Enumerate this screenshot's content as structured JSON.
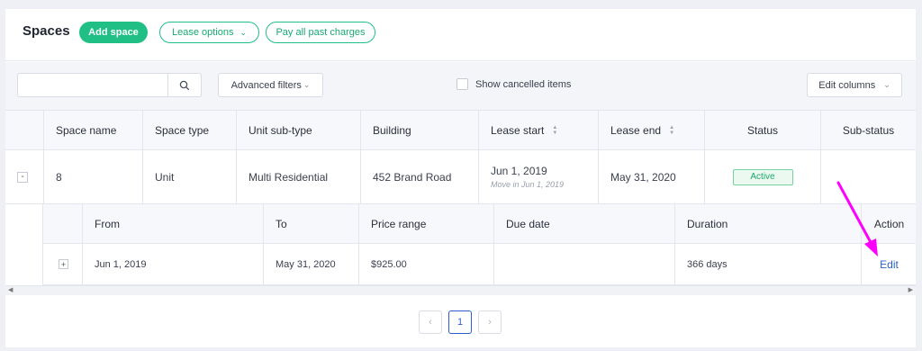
{
  "header": {
    "title": "Spaces",
    "add_space": "Add space",
    "lease_options": "Lease options",
    "pay_all": "Pay all past charges"
  },
  "toolbar": {
    "search_value": "",
    "advanced_filters": "Advanced filters",
    "show_cancelled": "Show cancelled items",
    "edit_columns": "Edit columns"
  },
  "table": {
    "columns": [
      "Space name",
      "Space type",
      "Unit sub-type",
      "Building",
      "Lease start",
      "Lease end",
      "Status",
      "Sub-status"
    ],
    "row": {
      "toggle": "-",
      "space_name": "8",
      "space_type": "Unit",
      "unit_sub_type": "Multi Residential",
      "building": "452 Brand Road",
      "lease_start": "Jun 1, 2019",
      "lease_start_note": "Move in Jun 1, 2019",
      "lease_end": "May 31, 2020",
      "status": "Active",
      "sub_status": ""
    }
  },
  "nested": {
    "columns": [
      "From",
      "To",
      "Price range",
      "Due date",
      "Duration",
      "Action"
    ],
    "row": {
      "toggle": "+",
      "from": "Jun 1, 2019",
      "to": "May 31, 2020",
      "price_range": "$925.00",
      "due_date": "",
      "duration": "366 days",
      "action": "Edit"
    }
  },
  "pagination": {
    "prev": "‹",
    "current": "1",
    "next": "›"
  },
  "colors": {
    "accent": "#1fbf86",
    "link": "#2962c9",
    "annotation_arrow": "#ff00ff",
    "status_active": "#1fa86a"
  },
  "icons": [
    "search-icon",
    "chevron-down-icon",
    "sort-icon",
    "pointer-arrow-icon"
  ]
}
